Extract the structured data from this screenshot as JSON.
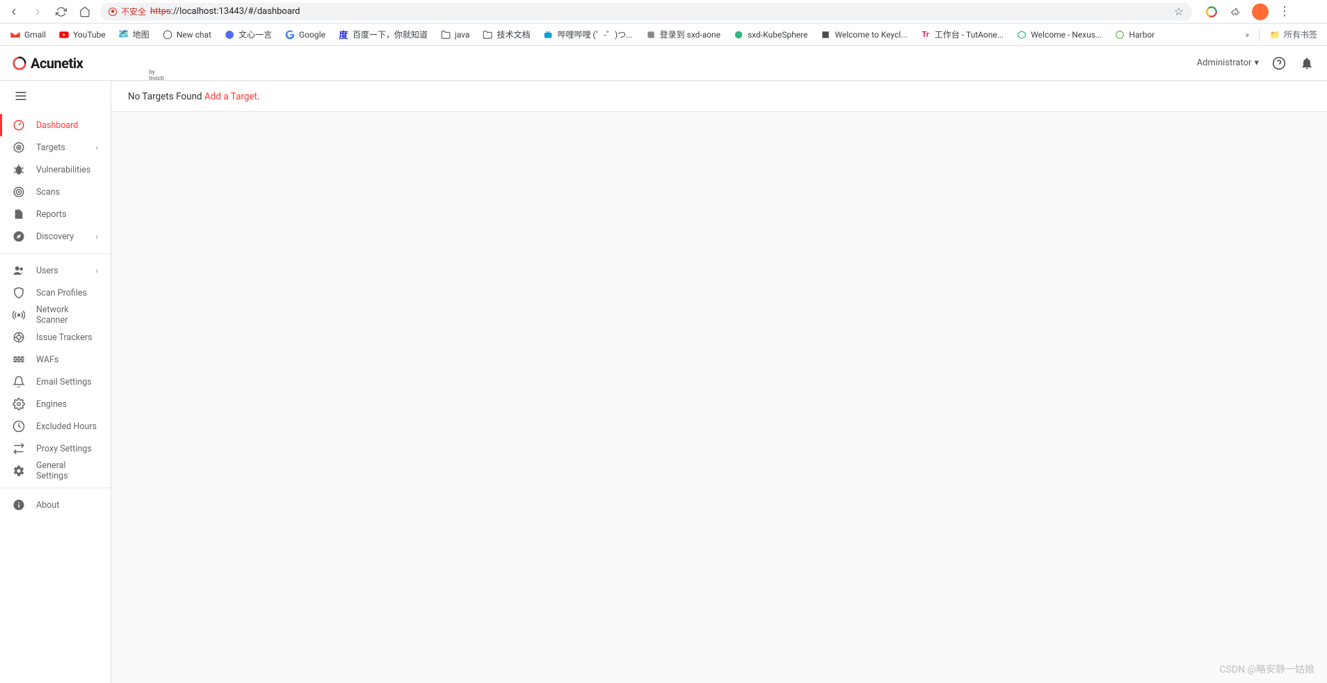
{
  "browser": {
    "url_insecure_label": "不安全",
    "url_https": "https",
    "url_rest": "://localhost:13443/#/dashboard"
  },
  "bookmarks": [
    {
      "icon": "gmail",
      "label": "Gmail"
    },
    {
      "icon": "youtube",
      "label": "YouTube"
    },
    {
      "icon": "maps",
      "label": "地图"
    },
    {
      "icon": "chat",
      "label": "New chat"
    },
    {
      "icon": "wenxin",
      "label": "文心一言"
    },
    {
      "icon": "google",
      "label": "Google"
    },
    {
      "icon": "baidu",
      "label": "百度一下，你就知道"
    },
    {
      "icon": "folder",
      "label": "java"
    },
    {
      "icon": "folder",
      "label": "技术文档"
    },
    {
      "icon": "bili",
      "label": "哔哩哔哩 (゜-゜)つ..."
    },
    {
      "icon": "generic",
      "label": "登录到 sxd-aone"
    },
    {
      "icon": "kubesphere",
      "label": "sxd-KubeSphere"
    },
    {
      "icon": "keycloak",
      "label": "Welcome to Keycl..."
    },
    {
      "icon": "tutaone",
      "label": "工作台 - TutAone..."
    },
    {
      "icon": "nexus",
      "label": "Welcome - Nexus..."
    },
    {
      "icon": "harbor",
      "label": "Harbor"
    }
  ],
  "bookmarks_all": "所有书签",
  "header": {
    "brand": "Acunetix",
    "sub": "by Invicti",
    "user": "Administrator"
  },
  "sidebar": {
    "group1": [
      {
        "key": "dashboard",
        "label": "Dashboard",
        "icon": "dashboard",
        "active": true
      },
      {
        "key": "targets",
        "label": "Targets",
        "icon": "target",
        "expand": true
      },
      {
        "key": "vulnerabilities",
        "label": "Vulnerabilities",
        "icon": "bug"
      },
      {
        "key": "scans",
        "label": "Scans",
        "icon": "radar"
      },
      {
        "key": "reports",
        "label": "Reports",
        "icon": "file"
      },
      {
        "key": "discovery",
        "label": "Discovery",
        "icon": "compass",
        "expand": true
      }
    ],
    "group2": [
      {
        "key": "users",
        "label": "Users",
        "icon": "users",
        "expand": true
      },
      {
        "key": "scan-profiles",
        "label": "Scan Profiles",
        "icon": "shield"
      },
      {
        "key": "network-scanner",
        "label": "Network Scanner",
        "icon": "antenna"
      },
      {
        "key": "issue-trackers",
        "label": "Issue Trackers",
        "icon": "track"
      },
      {
        "key": "wafs",
        "label": "WAFs",
        "icon": "wall"
      },
      {
        "key": "email-settings",
        "label": "Email Settings",
        "icon": "bell"
      },
      {
        "key": "engines",
        "label": "Engines",
        "icon": "gear"
      },
      {
        "key": "excluded-hours",
        "label": "Excluded Hours",
        "icon": "clock"
      },
      {
        "key": "proxy-settings",
        "label": "Proxy Settings",
        "icon": "proxy"
      },
      {
        "key": "general-settings",
        "label": "General Settings",
        "icon": "cog"
      }
    ],
    "group3": [
      {
        "key": "about",
        "label": "About",
        "icon": "info"
      }
    ]
  },
  "main": {
    "no_targets": "No Targets Found ",
    "add_target": "Add a Target",
    "period": "."
  },
  "watermark": "CSDN @略安静一姑娘"
}
